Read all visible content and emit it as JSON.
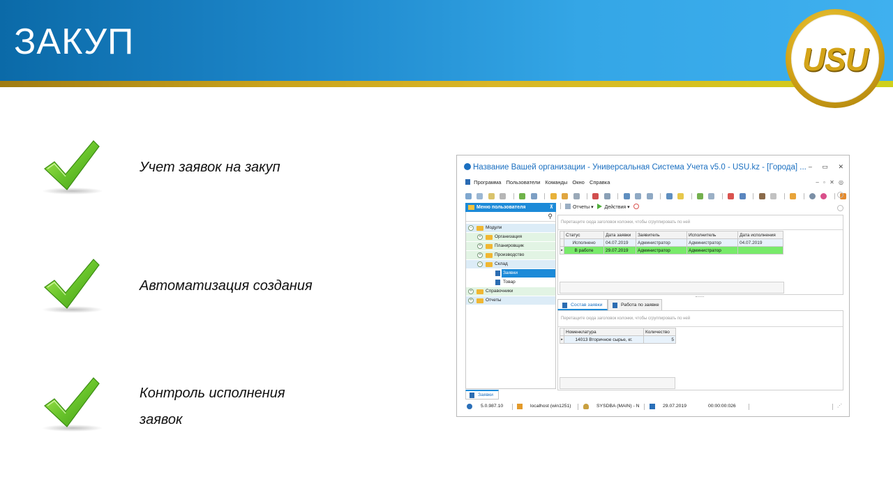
{
  "slide": {
    "title": "ЗАКУП",
    "logo_text": "USU",
    "bullets": [
      "Учет заявок на закуп",
      "Автоматизация создания",
      "Контроль исполнения заявок"
    ]
  },
  "app": {
    "window_title": "Название Вашей организации - Универсальная Система Учета v5.0 - USU.kz - [Города] ...",
    "window_controls": [
      "–",
      "▭",
      "✕"
    ],
    "menu": [
      "Программа",
      "Пользователи",
      "Команды",
      "Окно",
      "Справка"
    ],
    "left_panel": {
      "header": "Меню пользователя",
      "tree": [
        {
          "label": "Модули",
          "level": 0,
          "expanded": true
        },
        {
          "label": "Организация",
          "level": 1
        },
        {
          "label": "Планировщик",
          "level": 1
        },
        {
          "label": "Производство",
          "level": 1
        },
        {
          "label": "Склад",
          "level": 1,
          "expanded": true
        },
        {
          "label": "Заявки",
          "level": 2,
          "selected": true
        },
        {
          "label": "Товар",
          "level": 2
        },
        {
          "label": "Справочники",
          "level": 0
        },
        {
          "label": "Отчеты",
          "level": 0
        }
      ]
    },
    "toolbar2": {
      "reports": "Отчеты",
      "actions": "Действия"
    },
    "upper_grid": {
      "group_hint": "Перетащите сюда заголовок колонки, чтобы сгруппировать по ней",
      "columns": [
        "Статус",
        "Дата заявки",
        "Заявитель",
        "Исполнитель",
        "Дата исполнения"
      ],
      "rows": [
        [
          "Исполнено",
          "04.07.2019",
          "Администратор",
          "Администратор",
          "04.07.2019"
        ],
        [
          "В работе",
          "29.07.2019",
          "Администратор",
          "Администратор",
          ""
        ]
      ]
    },
    "detail_tabs": [
      "Состав заявки",
      "Работа по заявке"
    ],
    "lower_grid": {
      "group_hint": "Перетащите сюда заголовок колонки, чтобы сгруппировать по ней",
      "columns": [
        "Номенклатура",
        "Количество"
      ],
      "rows": [
        [
          "14013 Вторичное сырье, кг.",
          "5"
        ]
      ]
    },
    "bottom_tab": "Заявки",
    "status": {
      "version": "5.0.987.10",
      "server": "localhost (win1251)",
      "user": "SYSDBA (MAIN) - N",
      "date": "29.07.2019",
      "timer": "00:00:00:026"
    },
    "colors": {
      "accent": "#1c8ad8",
      "row_in_progress": "#78ea6a",
      "row_done": "#e8f2fb",
      "gold": "#d4a418"
    }
  }
}
